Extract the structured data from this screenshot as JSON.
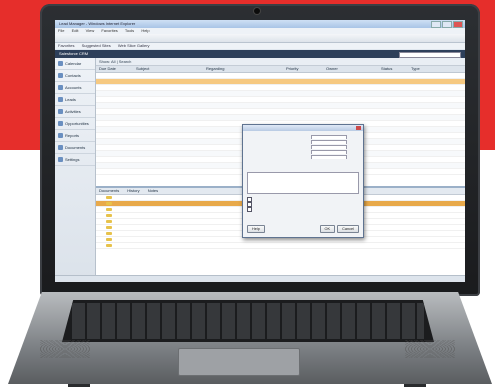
{
  "window": {
    "title": "Lead Manager - Windows Internet Explorer"
  },
  "menu": [
    "File",
    "Edit",
    "View",
    "Favorites",
    "Tools",
    "Help"
  ],
  "bookmarks": [
    "Favorites",
    "Suggested Sites",
    "Web Slice Gallery"
  ],
  "app": {
    "header": "Salesforce CRM"
  },
  "sidebar": {
    "items": [
      {
        "label": "Calendar",
        "icon": "calendar-icon"
      },
      {
        "label": "Contacts",
        "icon": "contacts-icon"
      },
      {
        "label": "Accounts",
        "icon": "accounts-icon"
      },
      {
        "label": "Leads",
        "icon": "leads-icon"
      },
      {
        "label": "Activities",
        "icon": "activities-icon"
      },
      {
        "label": "Opportunities",
        "icon": "opportunities-icon"
      },
      {
        "label": "Reports",
        "icon": "reports-icon"
      },
      {
        "label": "Documents",
        "icon": "documents-icon"
      },
      {
        "label": "Settings",
        "icon": "settings-icon"
      }
    ]
  },
  "grid": {
    "filter": "Show: All  |  Search",
    "columns": [
      "Due Date",
      "Subject",
      "Regarding",
      "Priority",
      "Owner",
      "Status",
      "Type"
    ],
    "rows": [
      [
        "",
        "",
        "",
        "",
        "",
        "",
        ""
      ],
      [
        "",
        "",
        "",
        "",
        "",
        "",
        ""
      ],
      [
        "",
        "",
        "",
        "",
        "",
        "",
        ""
      ],
      [
        "",
        "",
        "",
        "",
        "",
        "",
        ""
      ],
      [
        "",
        "",
        "",
        "",
        "",
        "",
        ""
      ],
      [
        "",
        "",
        "",
        "",
        "",
        "",
        ""
      ],
      [
        "",
        "",
        "",
        "",
        "",
        "",
        ""
      ],
      [
        "",
        "",
        "",
        "",
        "",
        "",
        ""
      ],
      [
        "",
        "",
        "",
        "",
        "",
        "",
        ""
      ],
      [
        "",
        "",
        "",
        "",
        "",
        "",
        ""
      ],
      [
        "",
        "",
        "",
        "",
        "",
        "",
        ""
      ],
      [
        "",
        "",
        "",
        "",
        "",
        "",
        ""
      ],
      [
        "",
        "",
        "",
        "",
        "",
        "",
        ""
      ],
      [
        "",
        "",
        "",
        "",
        "",
        "",
        ""
      ],
      [
        "",
        "",
        "",
        "",
        "",
        "",
        ""
      ],
      [
        "",
        "",
        "",
        "",
        "",
        "",
        ""
      ],
      [
        "",
        "",
        "",
        "",
        "",
        "",
        ""
      ]
    ],
    "selected_row": 1
  },
  "lower": {
    "tabs": [
      "Documents",
      "History",
      "Notes"
    ],
    "rows": [
      {
        "name": "",
        "date": "",
        "type": ""
      },
      {
        "name": "",
        "date": "",
        "type": ""
      },
      {
        "name": "",
        "date": "",
        "type": ""
      },
      {
        "name": "",
        "date": "",
        "type": ""
      },
      {
        "name": "",
        "date": "",
        "type": ""
      },
      {
        "name": "",
        "date": "",
        "type": ""
      },
      {
        "name": "",
        "date": "",
        "type": ""
      },
      {
        "name": "",
        "date": "",
        "type": ""
      },
      {
        "name": "",
        "date": "",
        "type": ""
      }
    ],
    "selected_row": 1
  },
  "dialog": {
    "title": "",
    "lines": [
      "",
      "",
      "",
      "",
      "",
      ""
    ],
    "notes_label": "",
    "checks": [
      "",
      "",
      ""
    ],
    "ok_label": "OK",
    "cancel_label": "Cancel",
    "help_label": "Help"
  },
  "statusbar": {
    "text": ""
  }
}
